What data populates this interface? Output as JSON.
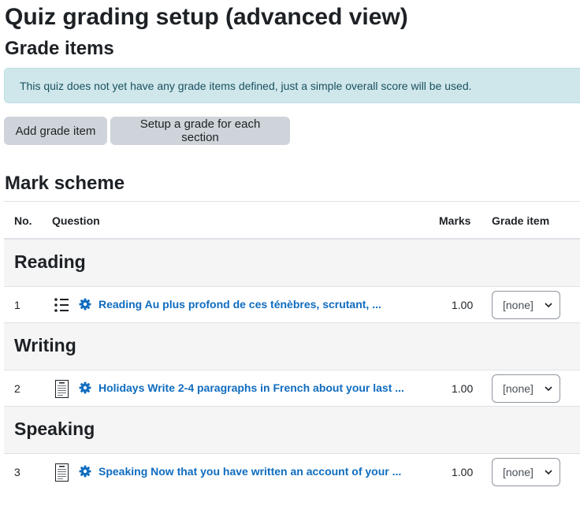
{
  "page": {
    "title": "Quiz grading setup (advanced view)"
  },
  "grade_items": {
    "heading": "Grade items",
    "notice": "This quiz does not yet have any grade items defined, just a simple overall score will be used.",
    "add_button": "Add grade item",
    "setup_button": "Setup a grade for each section"
  },
  "mark_scheme": {
    "heading": "Mark scheme",
    "columns": {
      "no": "No.",
      "question": "Question",
      "marks": "Marks",
      "grade_item": "Grade item"
    },
    "sections": [
      {
        "name": "Reading",
        "question": {
          "no": "1",
          "icon": "multichoice-icon",
          "text": "Reading Au plus profond de ces ténèbres, scrutant, ...",
          "marks": "1.00",
          "grade_item": "[none]"
        }
      },
      {
        "name": "Writing",
        "question": {
          "no": "2",
          "icon": "essay-icon",
          "text": "Holidays Write 2-4 paragraphs in French about your last ...",
          "marks": "1.00",
          "grade_item": "[none]"
        }
      },
      {
        "name": "Speaking",
        "question": {
          "no": "3",
          "icon": "essay-icon",
          "text": "Speaking Now that you have written an account of your ...",
          "marks": "1.00",
          "grade_item": "[none]"
        }
      }
    ]
  },
  "colors": {
    "link": "#0f6cbf",
    "alert_bg": "#cfe7eb",
    "button_bg": "#ced4da",
    "section_bg": "#f5f5f5"
  }
}
